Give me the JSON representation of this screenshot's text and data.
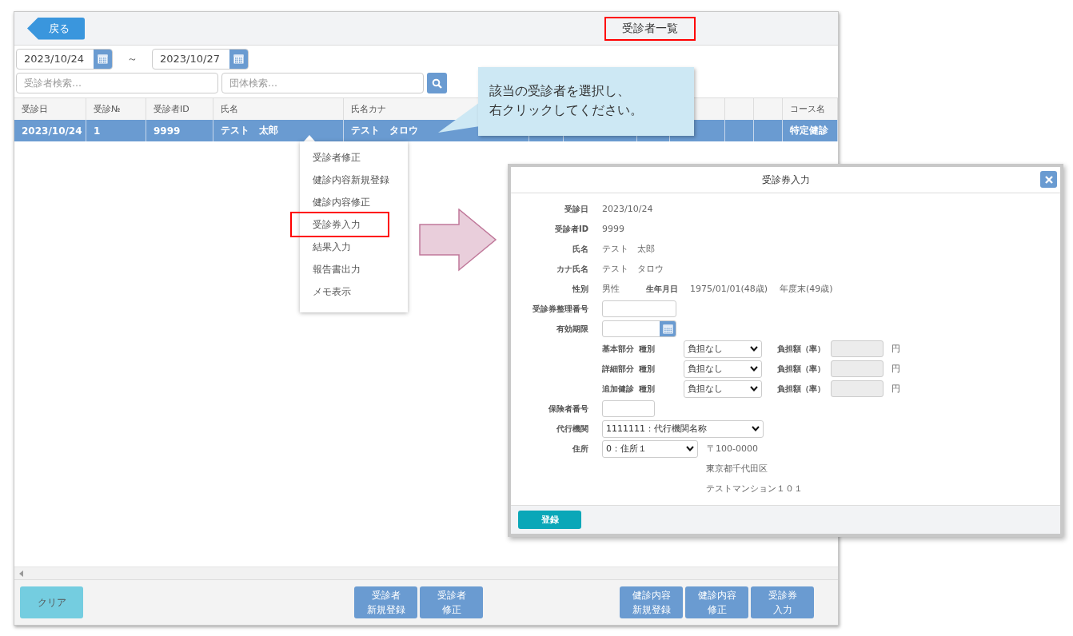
{
  "back_button": "戻る",
  "page_title": {
    "text": "受診者一覧",
    "annotated": true
  },
  "date_range": {
    "from": "2023/10/24",
    "separator": "～",
    "to": "2023/10/27"
  },
  "search": {
    "patient_placeholder": "受診者検索…",
    "group_placeholder": "団体検索…"
  },
  "table": {
    "columns": [
      "受診日",
      "受診№",
      "受診者ID",
      "氏名",
      "氏名カナ",
      "コース名"
    ],
    "rows": [
      {
        "selected": true,
        "cells": [
          "2023/10/24",
          "1",
          "9999",
          "テスト　太郎",
          "テスト　タロウ",
          "特定健診"
        ]
      }
    ]
  },
  "context_menu": {
    "items": [
      {
        "label": "受診者修正",
        "annotated": false
      },
      {
        "label": "健診内容新規登録",
        "annotated": false
      },
      {
        "label": "健診内容修正",
        "annotated": false
      },
      {
        "label": "受診券入力",
        "annotated": true
      },
      {
        "label": "結果入力",
        "annotated": false
      },
      {
        "label": "報告書出力",
        "annotated": false
      },
      {
        "label": "メモ表示",
        "annotated": false
      }
    ]
  },
  "callout": {
    "lines": [
      "該当の受診者を選択し、",
      "右クリックしてください。"
    ]
  },
  "modal": {
    "title": "受診券入力",
    "info": [
      {
        "label": "受診日",
        "value": "2023/10/24"
      },
      {
        "label": "受診者ID",
        "value": "9999"
      },
      {
        "label": "氏名",
        "value": "テスト　太郎"
      },
      {
        "label": "カナ氏名",
        "value": "テスト　タロウ"
      }
    ],
    "sex": {
      "label": "性別",
      "value": "男性",
      "birth_label": "生年月日",
      "birth_value": "1975/01/01(48歳)",
      "fiscal_age": "年度末(49歳)"
    },
    "ticket_number": {
      "label": "受診券整理番号"
    },
    "valid_until": {
      "label": "有効期限"
    },
    "burdens": [
      {
        "part": "基本部分",
        "type_label": "種別",
        "value": "負担なし",
        "amount_label": "負担額（率）",
        "unit": "円"
      },
      {
        "part": "詳細部分",
        "type_label": "種別",
        "value": "負担なし",
        "amount_label": "負担額（率）",
        "unit": "円"
      },
      {
        "part": "追加健診",
        "type_label": "種別",
        "value": "負担なし",
        "amount_label": "負担額（率）",
        "unit": "円"
      }
    ],
    "insurer_number": {
      "label": "保険者番号"
    },
    "agency": {
      "label": "代行機関",
      "value": "1111111：代行機関名称"
    },
    "address": {
      "label": "住所",
      "value": "0：住所１",
      "postal": "〒100-0000",
      "lines": [
        "東京都千代田区",
        "テストマンション１０１"
      ]
    },
    "submit": "登録"
  },
  "footer": {
    "clear": "クリア",
    "groups": [
      [
        {
          "lines": [
            "受診者",
            "新規登録"
          ]
        },
        {
          "lines": [
            "受診者",
            "修正"
          ]
        }
      ],
      [
        {
          "lines": [
            "健診内容",
            "新規登録"
          ]
        },
        {
          "lines": [
            "健診内容",
            "修正"
          ]
        },
        {
          "lines": [
            "受診券",
            "入力"
          ]
        }
      ]
    ]
  }
}
